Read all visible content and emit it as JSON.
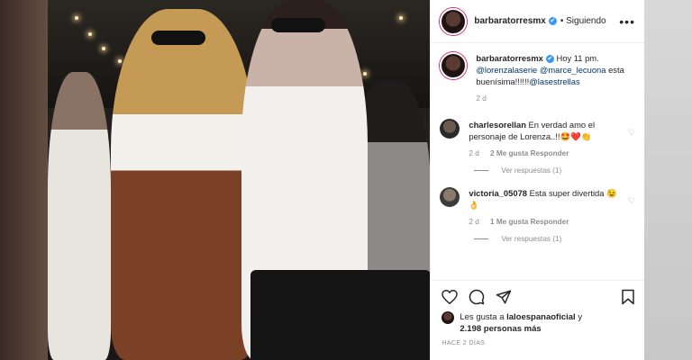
{
  "post": {
    "username": "barbaratorresmx",
    "verified_mark": "✔",
    "follow_status": "• Siguiendo",
    "more_icon": "•••"
  },
  "caption": {
    "username": "barbaratorresmx",
    "time": "Hoy 11 pm.",
    "mention1": "@lorenzalaserie",
    "mention2": "@marce_lecuona",
    "text": "esta buenísima!!!!!!",
    "mention3": "@lasestrellas",
    "age": "2 d"
  },
  "comments": [
    {
      "username": "charlesorellan",
      "text": "En verdad amo el personaje de Lorenza..!!🤩❤️👏",
      "age": "2 d",
      "likes": "2 Me gusta",
      "reply": "Responder",
      "view_replies": "Ver respuestas (1)",
      "heart": "♡"
    },
    {
      "username": "victoria_05078",
      "text": "Esta super divertida 😉👌",
      "age": "2 d",
      "likes": "1 Me gusta",
      "reply": "Responder",
      "view_replies": "Ver respuestas (1)",
      "heart": "♡"
    }
  ],
  "likes": {
    "prefix": "Les gusta a",
    "user": "laloespanaoficial",
    "joiner": "y",
    "count": "2.198 personas más"
  },
  "timestamp": "HACE 2 DÍAS",
  "colors": {
    "verified": "#3897f0",
    "mention": "#00376b",
    "muted": "#8e8e8e",
    "text": "#262626"
  }
}
